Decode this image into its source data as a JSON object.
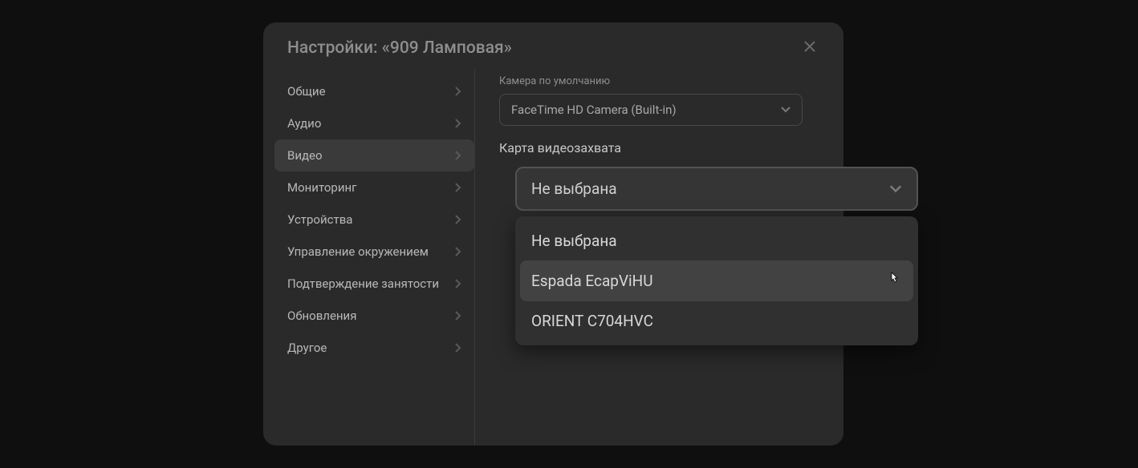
{
  "modal": {
    "title": "Настройки: «909 Ламповая»"
  },
  "sidebar": {
    "items": [
      {
        "label": "Общие"
      },
      {
        "label": "Аудио"
      },
      {
        "label": "Видео"
      },
      {
        "label": "Мониторинг"
      },
      {
        "label": "Устройства"
      },
      {
        "label": "Управление окружением"
      },
      {
        "label": "Подтверждение занятости"
      },
      {
        "label": "Обновления"
      },
      {
        "label": "Другое"
      }
    ]
  },
  "content": {
    "cameraLabel": "Камера по умолчанию",
    "cameraValue": "FaceTime HD Camera (Built-in)",
    "captureLabel": "Карта видеозахвата",
    "captureValue": "Не выбрана"
  },
  "dropdown": {
    "options": [
      {
        "label": "Не выбрана"
      },
      {
        "label": "Espada EcapViHU"
      },
      {
        "label": "ORIENT C704HVC"
      }
    ]
  }
}
